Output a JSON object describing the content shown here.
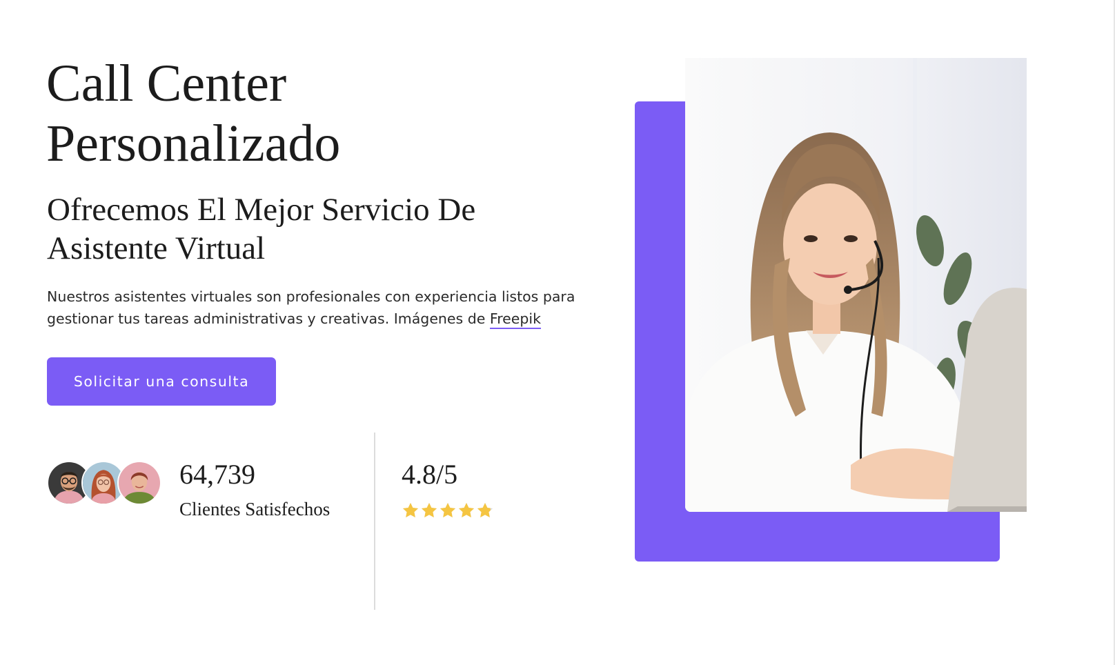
{
  "hero": {
    "title_line1": "Call Center",
    "title_line2": "Personalizado",
    "subtitle_line1": "Ofrecemos El Mejor Servicio De",
    "subtitle_line2": "Asistente Virtual",
    "description": "Nuestros asistentes virtuales son profesionales con experiencia listos para gestionar tus tareas administrativas y creativas. Imágenes de ",
    "description_link": "Freepik",
    "cta_label": "Solicitar una consulta",
    "photo": "woman-with-headset-at-laptop"
  },
  "stats": {
    "clients_count": "64,739",
    "clients_label": "Clientes Satisfechos",
    "avatars": [
      "man-with-glasses-avatar",
      "woman-with-red-hair-avatar",
      "woman-smiling-avatar"
    ],
    "rating_value": "4.8/5",
    "rating": 4.8,
    "rating_max": 5
  },
  "colors": {
    "accent": "#7b5cf5",
    "star": "#f5c542",
    "star_empty": "#d9d9d9",
    "text": "#1c1c1c"
  }
}
